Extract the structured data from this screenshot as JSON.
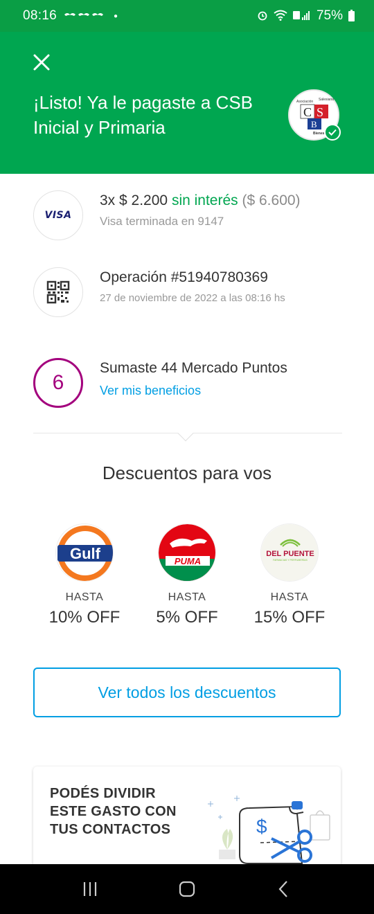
{
  "status_bar": {
    "time": "08:16",
    "battery": "75%",
    "notif_icons": [
      "bird-icon",
      "bird-icon",
      "bird-icon"
    ]
  },
  "header": {
    "title": "¡Listo! Ya le pagaste a CSB Inicial y Primaria",
    "background": "#00a650",
    "merchant_logo_text": [
      "Asociación",
      "Salesiana",
      "C",
      "S",
      "B",
      "Bienestar"
    ]
  },
  "payment": {
    "installments_prefix": "3x $ 2.200",
    "installments_interest": "sin interés",
    "installments_total": "($ 6.600)",
    "card": "Visa terminada en 9147",
    "card_brand": "VISA"
  },
  "operation": {
    "title": "Operación #51940780369",
    "date": "27 de noviembre de 2022 a las 08:16 hs"
  },
  "points": {
    "level": "6",
    "title": "Sumaste 44 Mercado Puntos",
    "link": "Ver mis beneficios",
    "color": "#a3007d"
  },
  "discounts": {
    "title": "Descuentos para vos",
    "items": [
      {
        "brand": "Gulf",
        "label": "HASTA",
        "value": "10% OFF"
      },
      {
        "brand": "PUMA",
        "label": "HASTA",
        "value": "5% OFF"
      },
      {
        "brand": "DEL PUENTE",
        "subbrand": "FARMACIAS Y PERFUMERÍAS",
        "label": "HASTA",
        "value": "15% OFF"
      }
    ],
    "button": "Ver todos los descuentos"
  },
  "split": {
    "text": "PODÉS DIVIDIR ESTE GASTO CON TUS CONTACTOS",
    "symbol": "$"
  },
  "colors": {
    "accent_blue": "#009ee3",
    "green": "#00a650"
  }
}
